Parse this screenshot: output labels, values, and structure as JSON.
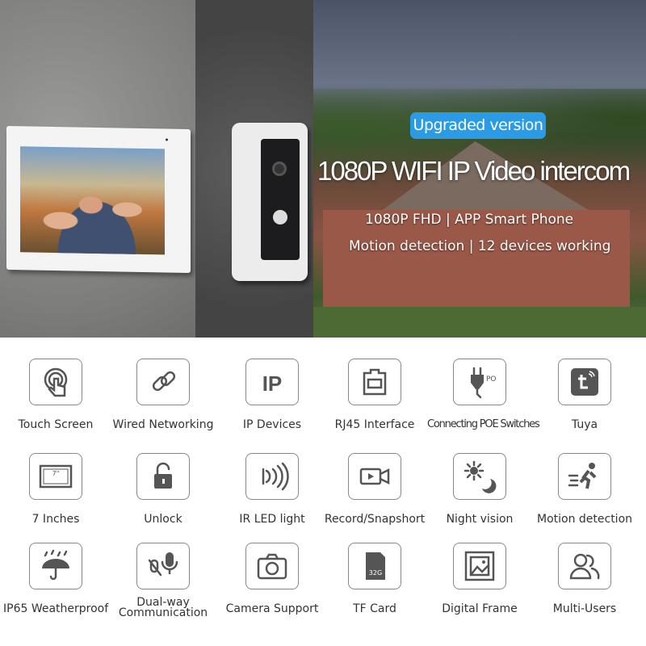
{
  "hero": {
    "badge": "Upgraded version",
    "title": "1080P WIFI IP Video intercom",
    "line1": "1080P FHD | APP Smart Phone",
    "line2": "Motion detection | 12 devices working",
    "badge_color": "#2b9be6"
  },
  "features": [
    {
      "label": "Touch Screen",
      "icon": "touch-icon"
    },
    {
      "label": "Wired Networking",
      "icon": "link-icon"
    },
    {
      "label": "IP Devices",
      "icon": "ip-icon"
    },
    {
      "label": "RJ45 Interface",
      "icon": "rj45-icon"
    },
    {
      "label": "Connecting POE Switches",
      "icon": "poe-plug-icon",
      "icon_text": "POE"
    },
    {
      "label": "Tuya",
      "icon": "tuya-icon"
    },
    {
      "label": "7 Inches",
      "icon": "screen-size-icon",
      "icon_text": "7\""
    },
    {
      "label": "Unlock",
      "icon": "unlock-icon"
    },
    {
      "label": "IR LED light",
      "icon": "ir-led-icon"
    },
    {
      "label": "Record/Snapshort",
      "icon": "video-camera-icon"
    },
    {
      "label": "Night vision",
      "icon": "sun-moon-icon"
    },
    {
      "label": "Motion detection",
      "icon": "running-man-icon"
    },
    {
      "label": "IP65 Weatherproof",
      "icon": "umbrella-rain-icon"
    },
    {
      "label": "Dual-way Communication",
      "icon": "microphone-icon"
    },
    {
      "label": "Camera Support",
      "icon": "camera-icon"
    },
    {
      "label": "TF Card",
      "icon": "sd-card-icon",
      "icon_text": "32G"
    },
    {
      "label": "Digital Frame",
      "icon": "picture-frame-icon"
    },
    {
      "label": "Multi-Users",
      "icon": "users-icon"
    }
  ]
}
